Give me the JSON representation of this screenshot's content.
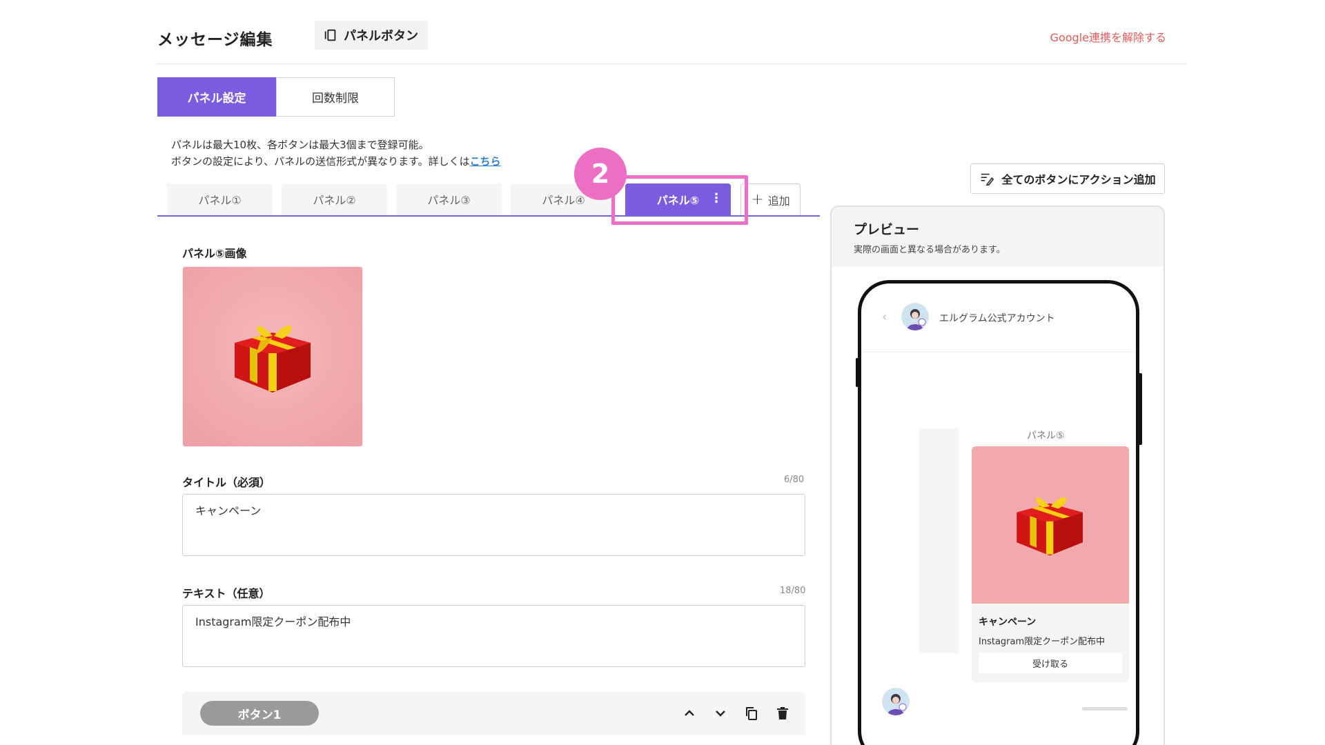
{
  "header": {
    "page_title": "メッセージ編集",
    "type_chip": "パネルボタン",
    "google_unlink": "Google連携を解除する"
  },
  "segment": {
    "items": [
      {
        "label": "パネル設定",
        "active": true
      },
      {
        "label": "回数制限",
        "active": false
      }
    ]
  },
  "description": {
    "line1": "パネルは最大10枚、各ボタンは最大3個まで登録可能。",
    "line2": "ボタンの設定により、パネルの送信形式が異なります。詳しくは",
    "link": "こちら"
  },
  "tabs": {
    "items": [
      {
        "label": "パネル①"
      },
      {
        "label": "パネル②"
      },
      {
        "label": "パネル③"
      },
      {
        "label": "パネル④"
      },
      {
        "label": "パネル⑤",
        "active": true
      }
    ],
    "add_label": "追加",
    "active_menu": "⋮"
  },
  "annotation": {
    "step": "2",
    "color": "#ec6ec5"
  },
  "editor": {
    "image_label": "パネル⑤画像",
    "title_label": "タイトル（必須）",
    "title_counter": "6/80",
    "title_value": "キャンペーン",
    "text_label": "テキスト（任意）",
    "text_counter": "18/80",
    "text_value": "Instagram限定クーポン配布中",
    "button_pill": "ボタン1",
    "row_icons": [
      "chevron-up-icon",
      "chevron-down-icon",
      "copy-icon",
      "trash-icon"
    ]
  },
  "actions": {
    "add_all_actions": "全てのボタンにアクション追加"
  },
  "preview": {
    "title": "プレビュー",
    "note": "実際の画面と異なる場合があります。",
    "account_name": "エルグラム公式アカウント",
    "panel_caption": "パネル⑤",
    "card_title": "キャンペーン",
    "card_text": "Instagram限定クーポン配布中",
    "card_button": "受け取る"
  },
  "colors": {
    "accent": "#7b5ce0",
    "danger_link": "#e05a5a",
    "link": "#2d7fd3",
    "highlight": "#ec6ec5"
  }
}
